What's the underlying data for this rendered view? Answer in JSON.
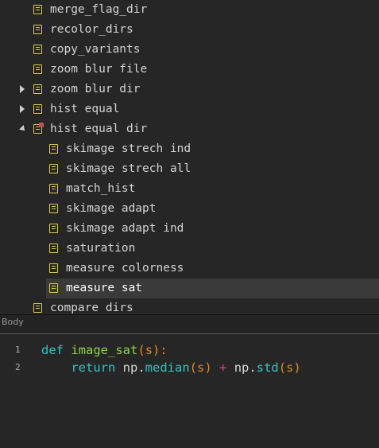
{
  "tree": {
    "nodes": [
      {
        "label": "merge_flag_dir",
        "depth": 0,
        "arrow": "none",
        "icon": "node-icon",
        "selected": false
      },
      {
        "label": "recolor_dirs",
        "depth": 0,
        "arrow": "none",
        "icon": "node-icon",
        "selected": false
      },
      {
        "label": "copy_variants",
        "depth": 0,
        "arrow": "none",
        "icon": "node-icon",
        "selected": false
      },
      {
        "label": "zoom blur file",
        "depth": 0,
        "arrow": "none",
        "icon": "node-icon",
        "selected": false
      },
      {
        "label": "zoom blur dir",
        "depth": 0,
        "arrow": "collapsed",
        "icon": "node-icon",
        "selected": false
      },
      {
        "label": "hist equal",
        "depth": 0,
        "arrow": "collapsed",
        "icon": "node-icon",
        "selected": false
      },
      {
        "label": "hist equal dir",
        "depth": 0,
        "arrow": "expanded",
        "icon": "clone-node-icon",
        "selected": false
      },
      {
        "label": "skimage strech ind",
        "depth": 1,
        "arrow": "none",
        "icon": "node-icon",
        "selected": false
      },
      {
        "label": "skimage strech all",
        "depth": 1,
        "arrow": "none",
        "icon": "node-icon",
        "selected": false
      },
      {
        "label": "match_hist",
        "depth": 1,
        "arrow": "none",
        "icon": "node-icon",
        "selected": false
      },
      {
        "label": "skimage adapt",
        "depth": 1,
        "arrow": "none",
        "icon": "node-icon",
        "selected": false
      },
      {
        "label": "skimage adapt ind",
        "depth": 1,
        "arrow": "none",
        "icon": "node-icon",
        "selected": false
      },
      {
        "label": "saturation",
        "depth": 1,
        "arrow": "none",
        "icon": "node-icon",
        "selected": false
      },
      {
        "label": "measure colorness",
        "depth": 1,
        "arrow": "none",
        "icon": "node-icon",
        "selected": false
      },
      {
        "label": "measure sat",
        "depth": 1,
        "arrow": "none",
        "icon": "node-icon",
        "selected": true
      },
      {
        "label": "compare dirs",
        "depth": 0,
        "arrow": "none",
        "icon": "node-icon",
        "selected": false
      }
    ]
  },
  "body_pane": {
    "title": "Body"
  },
  "editor": {
    "lines": [
      {
        "number": "1",
        "tokens": [
          {
            "t": "def",
            "c": "kw"
          },
          {
            "t": " ",
            "c": "plain"
          },
          {
            "t": "image_sat",
            "c": "fn"
          },
          {
            "t": "(",
            "c": "paren"
          },
          {
            "t": "s",
            "c": "param"
          },
          {
            "t": "):",
            "c": "paren"
          }
        ]
      },
      {
        "number": "2",
        "tokens": [
          {
            "t": "    ",
            "c": "plain"
          },
          {
            "t": "return",
            "c": "kw"
          },
          {
            "t": " np",
            "c": "plain"
          },
          {
            "t": ".",
            "c": "plain"
          },
          {
            "t": "median",
            "c": "method"
          },
          {
            "t": "(",
            "c": "paren"
          },
          {
            "t": "s",
            "c": "param"
          },
          {
            "t": ")",
            "c": "paren"
          },
          {
            "t": " ",
            "c": "plain"
          },
          {
            "t": "+",
            "c": "op"
          },
          {
            "t": " np",
            "c": "plain"
          },
          {
            "t": ".",
            "c": "plain"
          },
          {
            "t": "std",
            "c": "method"
          },
          {
            "t": "(",
            "c": "paren"
          },
          {
            "t": "s",
            "c": "param"
          },
          {
            "t": ")",
            "c": "paren"
          }
        ]
      }
    ]
  },
  "colors": {
    "background": "#262626",
    "node_icon": "#e0c84a",
    "keyword": "#2ec4c4",
    "function_name": "#8fd14f",
    "paren": "#e08a1e",
    "operator": "#e03c8a",
    "selected_row": "#3a3a3a"
  }
}
